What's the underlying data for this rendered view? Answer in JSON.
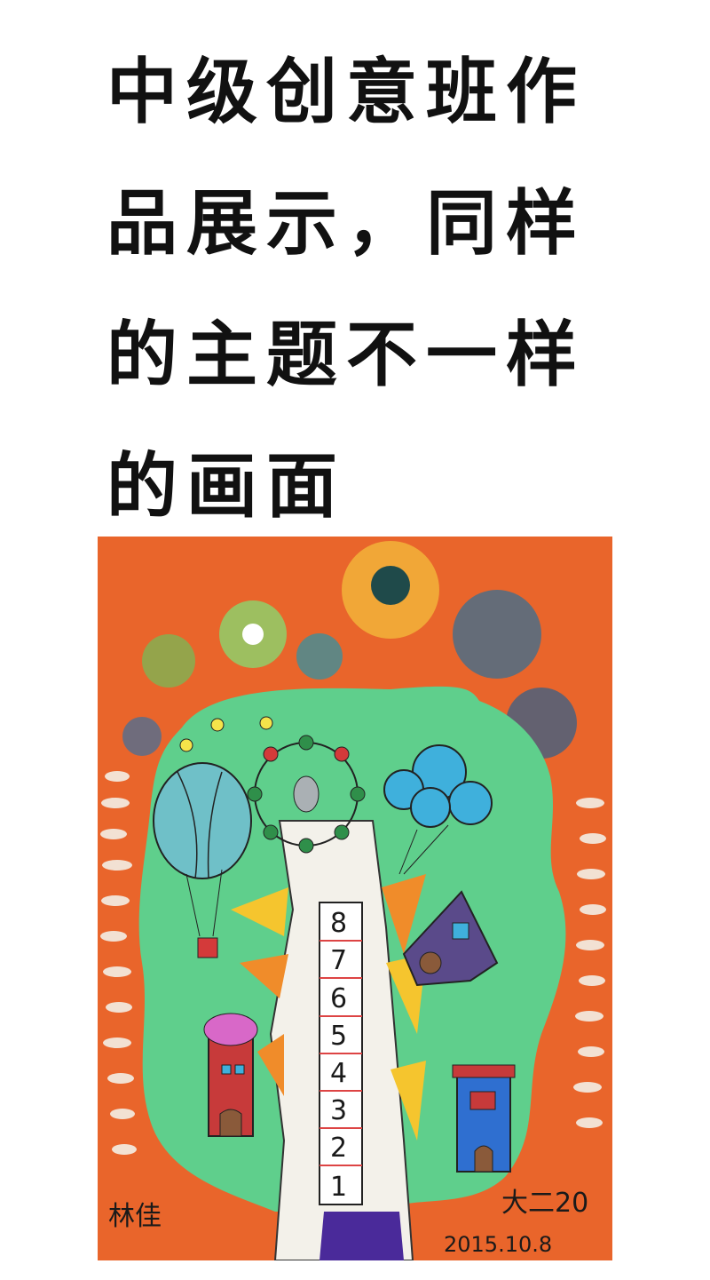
{
  "caption": {
    "lines": [
      "中级创意班作",
      "品展示，同样",
      "的主题不一样",
      "的画面"
    ]
  },
  "artwork": {
    "ladder_numbers": [
      "8",
      "7",
      "6",
      "5",
      "4",
      "3",
      "2",
      "1"
    ],
    "signature_left": "林佳",
    "signature_right": "大二20",
    "date": "2015.10.8",
    "colors": {
      "background": "#e9652b",
      "tree": "#5fcf8c",
      "trunk": "#f3f1ea"
    }
  }
}
